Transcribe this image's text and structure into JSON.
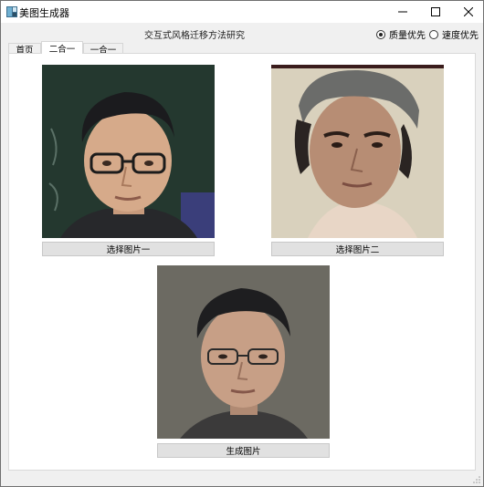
{
  "window": {
    "title": "美图生成器",
    "controls": {
      "minimize": "minimize-icon",
      "maximize": "maximize-icon",
      "close": "close-icon"
    }
  },
  "header": {
    "title": "交互式风格迁移方法研究",
    "modes": [
      {
        "label": "质量优先",
        "checked": true
      },
      {
        "label": "速度优先",
        "checked": false
      }
    ]
  },
  "tabs": [
    {
      "label": "首页",
      "active": false
    },
    {
      "label": "二合一",
      "active": true
    },
    {
      "label": "一合一",
      "active": false
    }
  ],
  "main": {
    "image_one": {
      "icon": "portrait-photo",
      "caption": ""
    },
    "image_two": {
      "icon": "portrait-photo",
      "caption": ""
    },
    "result_image": {
      "icon": "portrait-photo",
      "caption": ""
    },
    "select_one_label": "选择图片一",
    "select_two_label": "选择图片二",
    "generate_label": "生成图片"
  },
  "colors": {
    "window_bg": "#f0f0f0",
    "content_bg": "#ffffff",
    "button_bg": "#e1e1e1",
    "photo1_bg": "#24382f",
    "photo2_bg": "#d9d1bd",
    "photo3_bg": "#6c6a62"
  }
}
